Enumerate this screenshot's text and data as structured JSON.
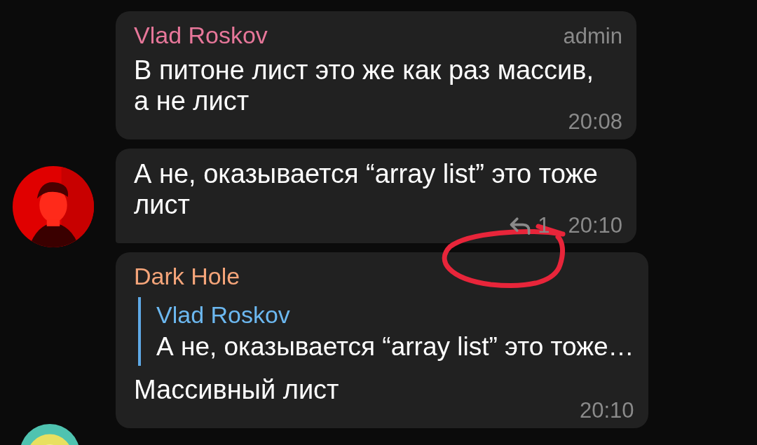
{
  "messages": [
    {
      "author": "Vlad Roskov",
      "color": "#e7779a",
      "badge": "admin",
      "text": "В питоне лист это же как раз массив, а не лист",
      "time": "20:08"
    },
    {
      "tail": true,
      "text": "А не, оказывается “array list” это тоже лист",
      "replies": "1",
      "time": "20:10"
    },
    {
      "author": "Dark Hole",
      "color": "#f5a57a",
      "reply": {
        "author": "Vlad Roskov",
        "text": "А не, оказывается “array list” это тоже…"
      },
      "text": "Массивный лист",
      "time": "20:10"
    }
  ],
  "annotation": {
    "kind": "circle"
  }
}
